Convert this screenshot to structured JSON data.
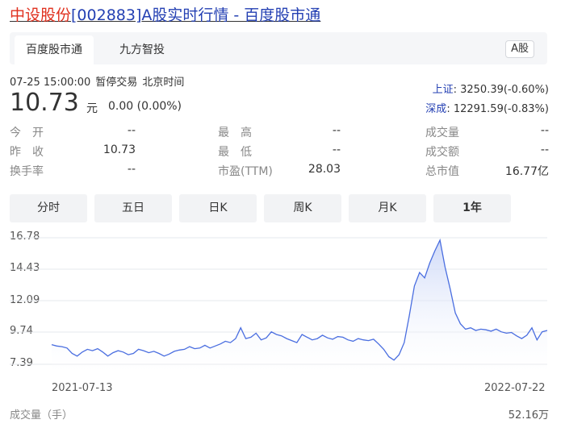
{
  "title": {
    "name": "中设股份",
    "code": "[002883]",
    "suffix": "A股实时行情 - 百度股市通"
  },
  "top_tabs": [
    {
      "label": "百度股市通",
      "active": true
    },
    {
      "label": "九方智投",
      "active": false
    }
  ],
  "market_badge": "A股",
  "status": {
    "datetime": "07-25 15:00:00",
    "state": "暂停交易",
    "timezone": "北京时间"
  },
  "quote": {
    "price": "10.73",
    "unit": "元",
    "change": "0.00 (0.00%)"
  },
  "indices": [
    {
      "name": "上证",
      "value": ": 3250.39(-0.60%)"
    },
    {
      "name": "深成",
      "value": ": 12291.59(-0.83%)"
    }
  ],
  "stats": {
    "open_label": "今　开",
    "open_value": "--",
    "high_label": "最　高",
    "high_value": "--",
    "volume_label": "成交量",
    "volume_value": "--",
    "prev_label": "昨　收",
    "prev_value": "10.73",
    "low_label": "最　低",
    "low_value": "--",
    "amount_label": "成交额",
    "amount_value": "--",
    "turnover_label": "换手率",
    "turnover_value": "--",
    "pe_label": "市盈(TTM)",
    "pe_value": "28.03",
    "mcap_label": "总市值",
    "mcap_value": "16.77亿"
  },
  "period_tabs": [
    {
      "label": "分时",
      "active": false
    },
    {
      "label": "五日",
      "active": false
    },
    {
      "label": "日K",
      "active": false
    },
    {
      "label": "周K",
      "active": false
    },
    {
      "label": "月K",
      "active": false
    },
    {
      "label": "1年",
      "active": true
    }
  ],
  "volume_label": "成交量（手）",
  "volume_max": "52.16万",
  "colors": {
    "line": "#4a6ee0",
    "fill_top": "#c9d5f7",
    "grid": "#e6e8ec",
    "title_red": "#e0301e",
    "title_blue": "#2440b3"
  },
  "chart_data": {
    "type": "area",
    "y_ticks": [
      "16.78",
      "14.43",
      "12.09",
      "9.74",
      "7.39"
    ],
    "ylim": [
      7.39,
      16.78
    ],
    "x_tick_labels": [
      "2021-07-13",
      "2022-07-22"
    ],
    "series": [
      {
        "values": [
          8.85,
          8.75,
          8.7,
          8.6,
          8.2,
          8.0,
          8.3,
          8.5,
          8.4,
          8.55,
          8.3,
          8.0,
          8.25,
          8.4,
          8.3,
          8.1,
          8.2,
          8.5,
          8.4,
          8.25,
          8.35,
          8.2,
          8.0,
          8.15,
          8.35,
          8.45,
          8.5,
          8.7,
          8.55,
          8.6,
          8.8,
          8.6,
          8.75,
          8.9,
          9.1,
          9.0,
          9.3,
          10.1,
          9.3,
          9.4,
          9.7,
          9.2,
          9.35,
          9.8,
          9.6,
          9.5,
          9.3,
          9.15,
          9.0,
          9.6,
          9.4,
          9.2,
          9.3,
          9.55,
          9.35,
          9.25,
          9.45,
          9.4,
          9.2,
          9.1,
          9.3,
          9.2,
          9.15,
          9.25,
          8.9,
          8.5,
          7.95,
          7.7,
          8.1,
          9.0,
          11.0,
          13.2,
          14.2,
          13.8,
          14.9,
          15.8,
          16.6,
          14.6,
          13.0,
          11.2,
          10.4,
          10.0,
          10.1,
          9.9,
          10.0,
          9.95,
          9.85,
          10.0,
          9.8,
          9.7,
          9.75,
          9.5,
          9.3,
          9.55,
          10.1,
          9.2,
          9.8,
          9.9
        ]
      }
    ]
  }
}
